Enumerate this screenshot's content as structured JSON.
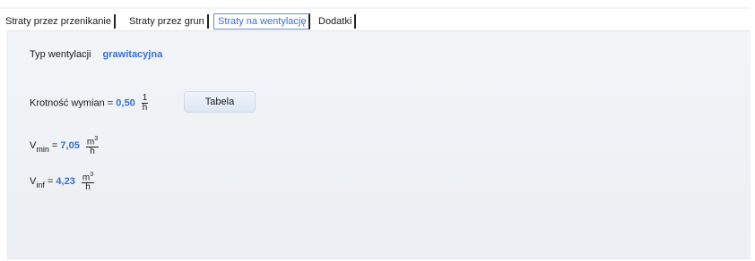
{
  "tabs": [
    {
      "label": "Straty przez przenikanie",
      "active": false
    },
    {
      "label": "Straty przez grun",
      "active": false
    },
    {
      "label": "Straty na wentylację",
      "active": true
    },
    {
      "label": "Dodatki",
      "active": false
    }
  ],
  "ventilation": {
    "type_label": "Typ wentylacji",
    "type_value": "grawitacyjna",
    "rate_label": "Krotność wymian =",
    "rate_value": "0,50",
    "rate_unit_num": "1",
    "rate_unit_den": "h",
    "table_button": "Tabela",
    "vmin_symbol": "V",
    "vmin_sub": "min",
    "vmin_eq": "=",
    "vmin_value": "7,05",
    "vmin_unit_num": "m",
    "vmin_unit_sup": "3",
    "vmin_unit_den": "h",
    "vinf_symbol": "V",
    "vinf_sub": "inf",
    "vinf_eq": "=",
    "vinf_value": "4,23",
    "vinf_unit_num": "m",
    "vinf_unit_sup": "3",
    "vinf_unit_den": "h"
  },
  "colors": {
    "value": "#3a6fcf",
    "active_tab": "#3a6fcf",
    "panel_bg": "#eff2f6"
  }
}
